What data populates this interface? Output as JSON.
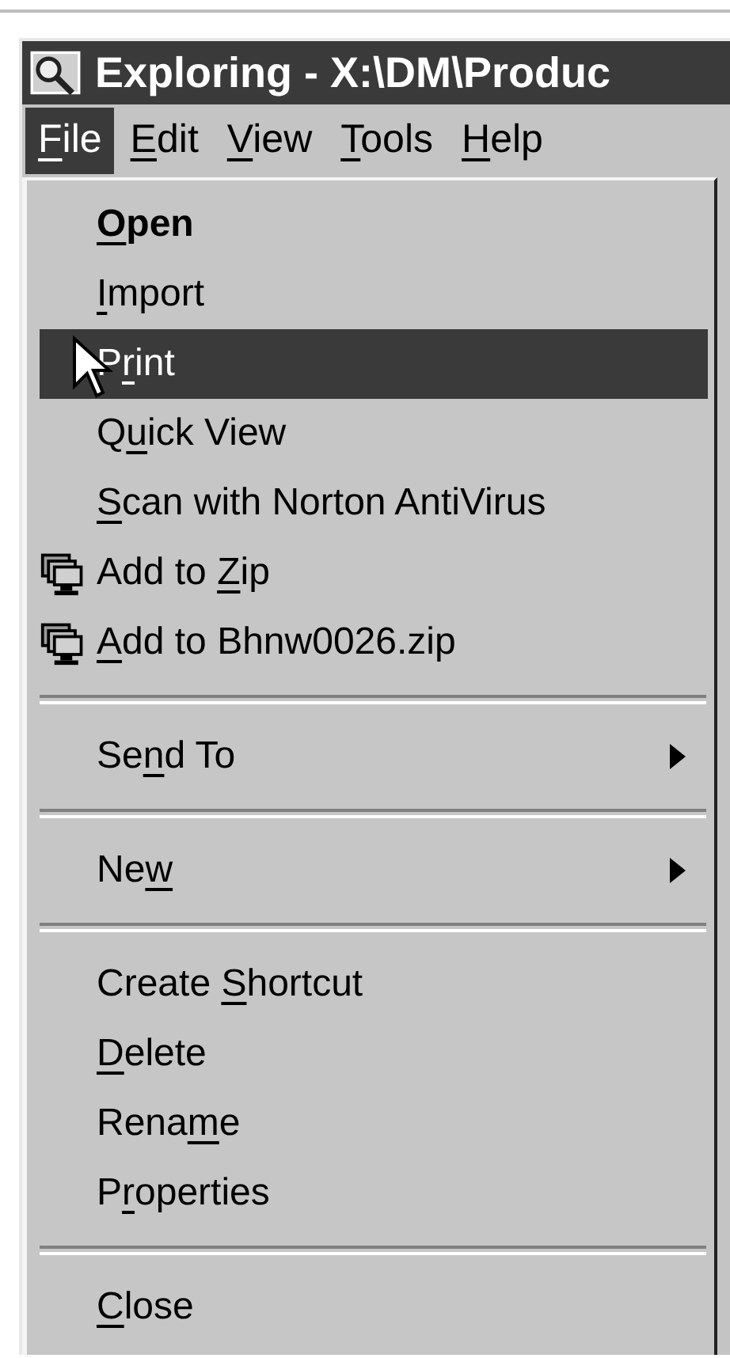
{
  "window": {
    "title": "Exploring - X:\\DM\\Produc"
  },
  "menu_bar": [
    {
      "label": {
        "key": "F",
        "after": "ile"
      },
      "selected": true
    },
    {
      "label": {
        "key": "E",
        "after": "dit"
      },
      "selected": false
    },
    {
      "label": {
        "key": "V",
        "after": "iew"
      },
      "selected": false
    },
    {
      "label": {
        "key": "T",
        "after": "ools"
      },
      "selected": false
    },
    {
      "label": {
        "key": "H",
        "after": "elp"
      },
      "selected": false
    }
  ],
  "file_menu": [
    {
      "kind": "command",
      "label": {
        "key": "O",
        "after": "pen"
      },
      "default": true,
      "selected": false
    },
    {
      "kind": "command",
      "label": {
        "key": "I",
        "after": "mport"
      },
      "default": false,
      "selected": false
    },
    {
      "kind": "command",
      "label": {
        "before": "P",
        "key": "r",
        "after": "int"
      },
      "default": false,
      "selected": true
    },
    {
      "kind": "command",
      "label": {
        "before": "Q",
        "key": "u",
        "after": "ick View"
      },
      "default": false,
      "selected": false
    },
    {
      "kind": "command",
      "label": {
        "key": "S",
        "after": "can with Norton AntiVirus"
      },
      "default": false,
      "selected": false
    },
    {
      "kind": "command_with_icon",
      "label": {
        "before": "Add to ",
        "key": "Z",
        "after": "ip"
      },
      "default": false,
      "selected": false
    },
    {
      "kind": "command_with_icon",
      "label": {
        "key": "A",
        "after": "dd to Bhnw0026.zip"
      },
      "default": false,
      "selected": false
    },
    {
      "kind": "separator"
    },
    {
      "kind": "submenu",
      "label": {
        "before": "Se",
        "key": "n",
        "after": "d To"
      },
      "default": false,
      "selected": false
    },
    {
      "kind": "separator"
    },
    {
      "kind": "submenu",
      "label": {
        "before": "Ne",
        "key": "w"
      },
      "default": false,
      "selected": false
    },
    {
      "kind": "separator"
    },
    {
      "kind": "command",
      "label": {
        "before": "Create ",
        "key": "S",
        "after": "hortcut"
      },
      "default": false,
      "selected": false
    },
    {
      "kind": "command",
      "label": {
        "key": "D",
        "after": "elete"
      },
      "default": false,
      "selected": false
    },
    {
      "kind": "command",
      "label": {
        "before": "Rena",
        "key": "m",
        "after": "e"
      },
      "default": false,
      "selected": false
    },
    {
      "kind": "command",
      "label": {
        "before": "P",
        "key": "r",
        "after": "operties"
      },
      "default": false,
      "selected": false
    },
    {
      "kind": "separator"
    },
    {
      "kind": "command",
      "label": {
        "key": "C",
        "after": "lose"
      },
      "default": false,
      "selected": false
    }
  ]
}
